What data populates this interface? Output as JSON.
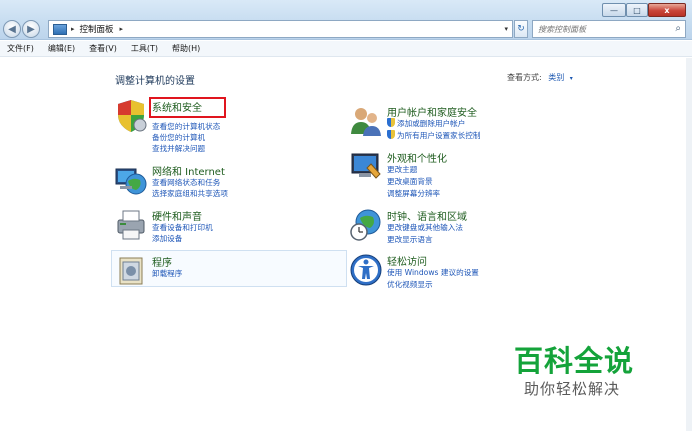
{
  "window": {
    "controls": {
      "minimize": "—",
      "maximize": "□",
      "close": "x"
    }
  },
  "address_bar": {
    "crumb": "控制面板",
    "separator": "▸",
    "dropdown": "▾"
  },
  "refresh_glyph": "↻",
  "search": {
    "placeholder": "搜索控制面板"
  },
  "menu": [
    "文件(F)",
    "编辑(E)",
    "查看(V)",
    "工具(T)",
    "帮助(H)"
  ],
  "main": {
    "title": "调整计算机的设置",
    "view_by": {
      "label": "查看方式:",
      "value": "类别",
      "arrow": "▾"
    }
  },
  "categories": {
    "system_security": {
      "title": "系统和安全",
      "links": [
        "查看您的计算机状态",
        "备份您的计算机",
        "查找并解决问题"
      ]
    },
    "network": {
      "title": "网络和 Internet",
      "links": [
        "查看网络状态和任务",
        "选择家庭组和共享选项"
      ]
    },
    "hardware": {
      "title": "硬件和声音",
      "links": [
        "查看设备和打印机",
        "添加设备"
      ]
    },
    "programs": {
      "title": "程序",
      "links": [
        "卸载程序"
      ]
    },
    "user_accounts": {
      "title": "用户帐户和家庭安全",
      "links": [
        "添加或删除用户帐户",
        "为所有用户设置家长控制"
      ]
    },
    "appearance": {
      "title": "外观和个性化",
      "links": [
        "更改主题",
        "更改桌面背景",
        "调整屏幕分辨率"
      ]
    },
    "clock_region": {
      "title": "时钟、语言和区域",
      "links": [
        "更改键盘或其他输入法",
        "更改显示语言"
      ]
    },
    "ease_access": {
      "title": "轻松访问",
      "links": [
        "使用 Windows 建议的设置",
        "优化视频显示"
      ]
    }
  },
  "watermark": {
    "main": "百科全说",
    "sub": "助你轻松解决"
  },
  "colors": {
    "highlight": "#e0151e",
    "category_title": "#1e5c1e",
    "link": "#1f57b8",
    "watermark": "#14a33a"
  }
}
